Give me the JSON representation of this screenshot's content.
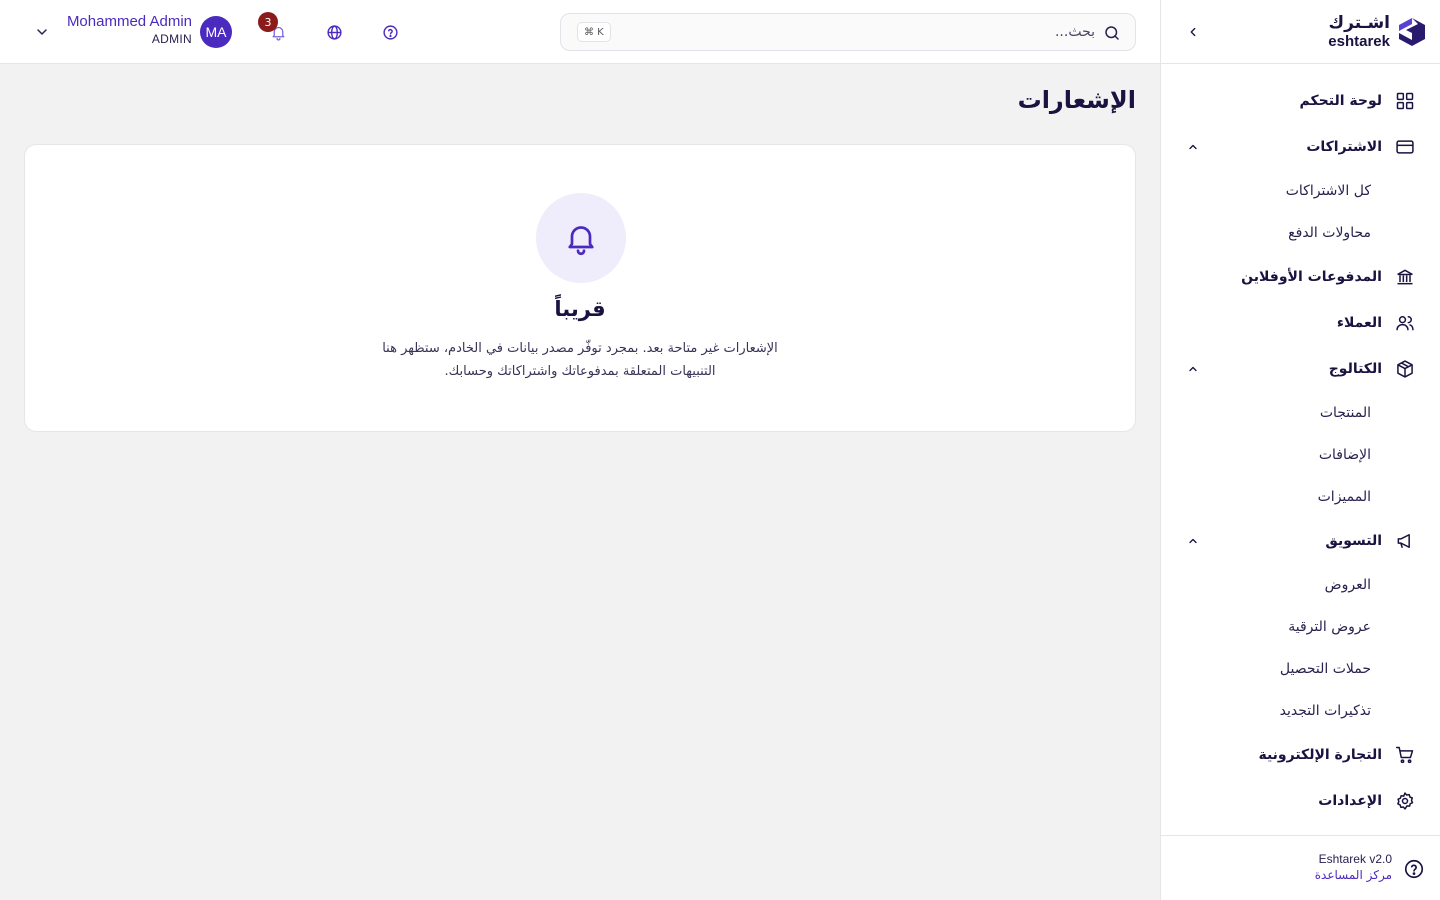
{
  "brand": {
    "name_ar": "اشـترك",
    "name_en": "eshtarek",
    "accent_color": "#4b2bbf",
    "dark_color": "#1a1240"
  },
  "topbar": {
    "search_placeholder": "بحث...",
    "search_shortcut": "⌘ K",
    "notification_count": "3",
    "user": {
      "initials": "MA",
      "name": "Mohammed Admin",
      "role": "ADMIN"
    },
    "icons": {
      "notifications": "bell-icon",
      "language": "globe-icon",
      "help": "help-circle-icon",
      "search": "search-icon",
      "user_menu": "chevron-down-icon"
    }
  },
  "sidebar": {
    "items": [
      {
        "label": "لوحة التحكم",
        "icon": "dashboard-icon"
      },
      {
        "label": "الاشتراكات",
        "icon": "credit-card-icon",
        "expanded": true,
        "children": [
          "كل الاشتراكات",
          "محاولات الدفع"
        ]
      },
      {
        "label": "المدفوعات الأوفلاين",
        "icon": "bank-icon"
      },
      {
        "label": "العملاء",
        "icon": "users-icon"
      },
      {
        "label": "الكتالوج",
        "icon": "package-icon",
        "expanded": true,
        "children": [
          "المنتجات",
          "الإضافات",
          "المميزات"
        ]
      },
      {
        "label": "التسويق",
        "icon": "megaphone-icon",
        "expanded": true,
        "children": [
          "العروض",
          "عروض الترقية",
          "حملات التحصيل",
          "تذكيرات التجديد"
        ]
      },
      {
        "label": "التجارة الإلكترونية",
        "icon": "cart-icon"
      },
      {
        "label": "الإعدادات",
        "icon": "gear-icon"
      }
    ],
    "footer": {
      "version": "Eshtarek v2.0",
      "help_link": "مركز المساعدة"
    }
  },
  "main": {
    "page_title": "الإشعارات",
    "empty_state": {
      "title": "قريباً",
      "description": "الإشعارات غير متاحة بعد. بمجرد توفّر مصدر بيانات في الخادم، ستظهر هنا التنبيهات المتعلقة بمدفوعاتك واشتراكاتك وحسابك."
    }
  }
}
